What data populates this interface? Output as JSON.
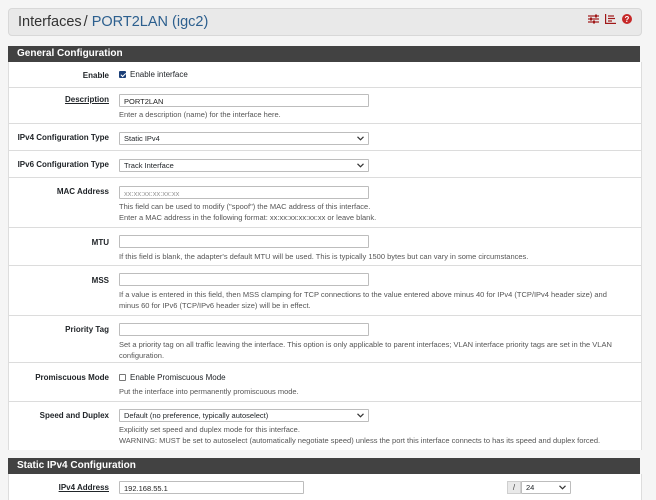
{
  "header": {
    "title": "Interfaces",
    "separator": "/",
    "interface": "PORT2LAN (igc2)"
  },
  "icons": {
    "settings": "sliders-icon",
    "chart": "bar-chart-icon",
    "help": "help-icon"
  },
  "colors": {
    "accent": "#2c5f8e",
    "section_bg": "#424242",
    "help_icon": "#c62828"
  },
  "general": {
    "heading": "General Configuration",
    "enable": {
      "label": "Enable",
      "checkbox_label": "Enable interface",
      "checked": true
    },
    "description": {
      "label": "Description",
      "value": "PORT2LAN",
      "help": "Enter a description (name) for the interface here."
    },
    "ipv4_type": {
      "label": "IPv4 Configuration Type",
      "value": "Static IPv4"
    },
    "ipv6_type": {
      "label": "IPv6 Configuration Type",
      "value": "Track Interface"
    },
    "mac": {
      "label": "MAC Address",
      "placeholder": "xx:xx:xx:xx:xx:xx",
      "help1": "This field can be used to modify (\"spoof\") the MAC address of this interface.",
      "help2": "Enter a MAC address in the following format: xx:xx:xx:xx:xx:xx or leave blank."
    },
    "mtu": {
      "label": "MTU",
      "value": "",
      "help": "If this field is blank, the adapter's default MTU will be used. This is typically 1500 bytes but can vary in some circumstances."
    },
    "mss": {
      "label": "MSS",
      "value": "",
      "help1": "If a value is entered in this field, then MSS clamping for TCP connections to the value entered above minus 40 for IPv4 (TCP/IPv4 header size) and",
      "help2": "minus 60 for IPv6 (TCP/IPv6 header size) will be in effect."
    },
    "priority": {
      "label": "Priority Tag",
      "value": "",
      "help1": "Set a priority tag on all traffic leaving the interface. This option is only applicable to parent interfaces; VLAN interface priority tags are set in the VLAN",
      "help2": "configuration."
    },
    "promisc": {
      "label": "Promiscuous Mode",
      "checkbox_label": "Enable Promiscuous Mode",
      "checked": false,
      "help": "Put the interface into permanently promiscuous mode."
    },
    "speed": {
      "label": "Speed and Duplex",
      "value": "Default (no preference, typically autoselect)",
      "help1": "Explicitly set speed and duplex mode for this interface.",
      "help2": "WARNING: MUST be set to autoselect (automatically negotiate speed) unless the port this interface connects to has its speed and duplex forced."
    }
  },
  "static_ipv4": {
    "heading": "Static IPv4 Configuration",
    "address": {
      "label": "IPv4 Address",
      "value": "192.168.55.1",
      "slash": "/",
      "cidr": "24"
    }
  }
}
